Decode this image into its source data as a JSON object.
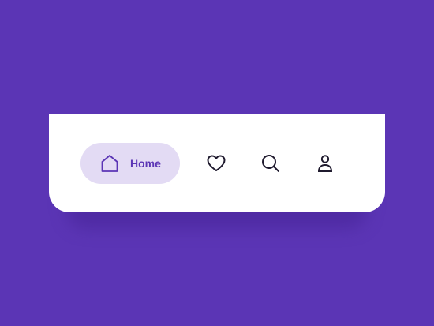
{
  "colors": {
    "background": "#5b35b5",
    "navbar": "#ffffff",
    "active_pill": "#e3dbf4",
    "accent": "#5b35b5",
    "icon": "#1f1a2e"
  },
  "navbar": {
    "active": "home",
    "items": [
      {
        "id": "home",
        "label": "Home",
        "icon": "home-icon"
      },
      {
        "id": "favorites",
        "icon": "heart-icon"
      },
      {
        "id": "search",
        "icon": "search-icon"
      },
      {
        "id": "profile",
        "icon": "user-icon"
      }
    ]
  }
}
